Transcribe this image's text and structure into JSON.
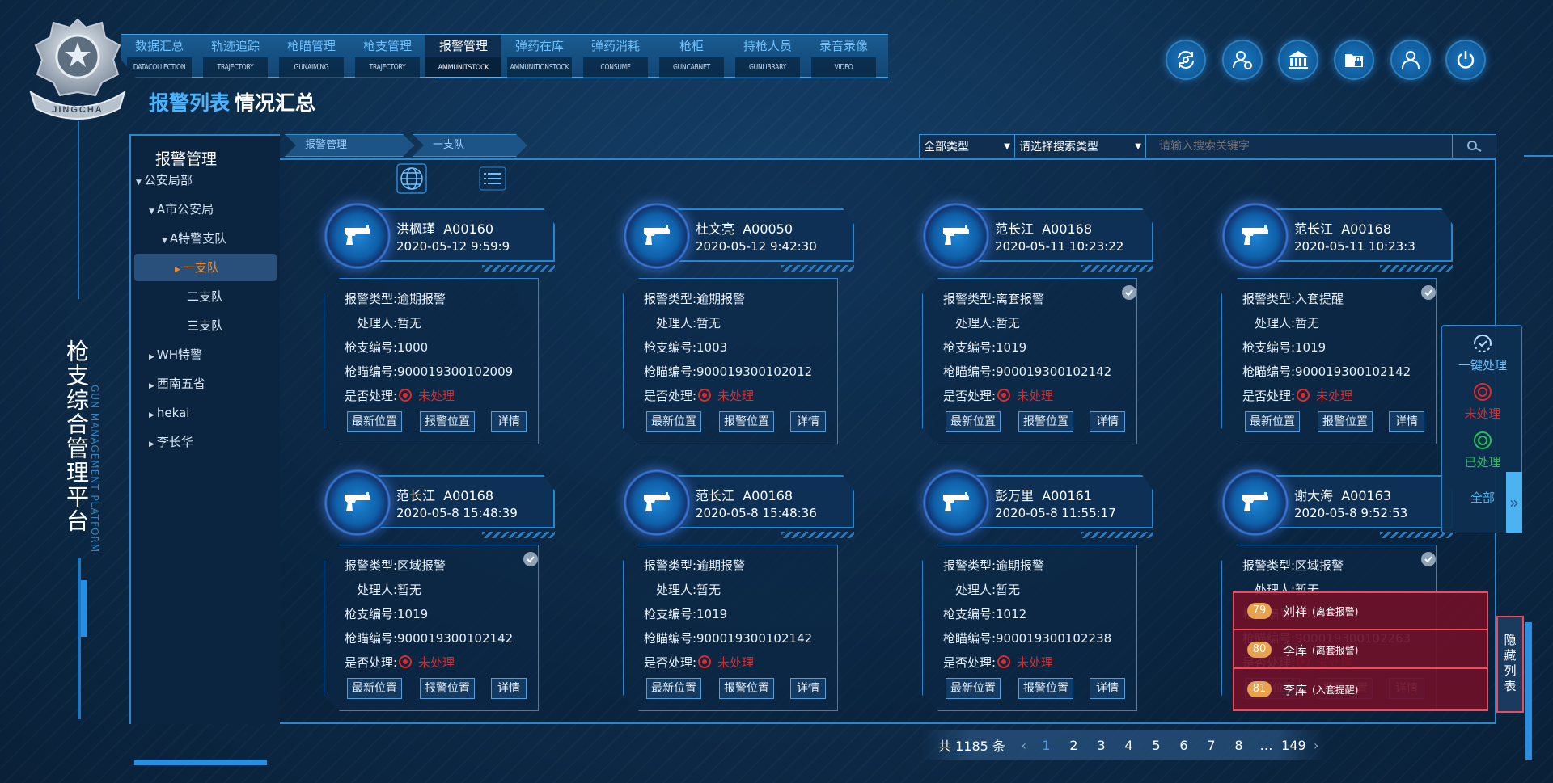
{
  "logo": {
    "text": "JINGCHA"
  },
  "nav": [
    {
      "cn": "数据汇总",
      "en": "DATACOLLECTION"
    },
    {
      "cn": "轨迹追踪",
      "en": "TRAJECTORY"
    },
    {
      "cn": "枪瞄管理",
      "en": "GUNAIMING"
    },
    {
      "cn": "枪支管理",
      "en": "TRAJECTORY"
    },
    {
      "cn": "报警管理",
      "en": "AMMUNITSTOCK",
      "active": true
    },
    {
      "cn": "弹药在库",
      "en": "AMMUNITIONSTOCK"
    },
    {
      "cn": "弹药消耗",
      "en": "CONSUME"
    },
    {
      "cn": "枪柜",
      "en": "GUNCABNET"
    },
    {
      "cn": "持枪人员",
      "en": "GUNLIBRARY"
    },
    {
      "cn": "录音录像",
      "en": "VIDEO"
    }
  ],
  "top_icons": [
    "sync-icon",
    "user-settings-icon",
    "bank-icon",
    "folder-lock-icon",
    "user-icon",
    "power-icon"
  ],
  "page_title": {
    "main": "报警列表",
    "sub": "情况汇总"
  },
  "platform": {
    "cn": "枪支综合管理平台",
    "en": "GUN MANAGEMENT PLATFORM"
  },
  "sidebar": {
    "title": "报警管理",
    "items": [
      {
        "label": "公安局部",
        "arrow": "▼"
      },
      {
        "label": "A市公安局",
        "arrow": "▼"
      },
      {
        "label": "A特警支队",
        "arrow": "▼"
      },
      {
        "label": "一支队",
        "arrow": "▶",
        "active": true
      },
      {
        "label": "二支队",
        "arrow": ""
      },
      {
        "label": "三支队",
        "arrow": ""
      },
      {
        "label": "WH特警",
        "arrow": "▶"
      },
      {
        "label": "西南五省",
        "arrow": "▶"
      },
      {
        "label": "hekai",
        "arrow": "▶"
      },
      {
        "label": "李长华",
        "arrow": "▶"
      }
    ]
  },
  "breadcrumb": [
    "报警管理",
    "一支队"
  ],
  "search": {
    "type_select": "全部类型",
    "field_select": "请选择搜索类型",
    "placeholder": "请输入搜索关键字"
  },
  "card_labels": {
    "type": "报警类型:",
    "handler": "处理人:",
    "gun_no": "枪支编号:",
    "sight_no": "枪瞄编号:",
    "processed": "是否处理:",
    "btn_latest": "最新位置",
    "btn_alarm": "报警位置",
    "btn_detail": "详情"
  },
  "cards": [
    {
      "name": "洪枫瑾",
      "code": "A00160",
      "time": "2020-05-12 9:59:9",
      "type": "逾期报警",
      "handler": "暂无",
      "gun_no": "1000",
      "sight_no": "900019300102009",
      "state": "未处理",
      "checked": false
    },
    {
      "name": "杜文亮",
      "code": "A00050",
      "time": "2020-05-12 9:42:30",
      "type": "逾期报警",
      "handler": "暂无",
      "gun_no": "1003",
      "sight_no": "900019300102012",
      "state": "未处理",
      "checked": false
    },
    {
      "name": "范长江",
      "code": "A00168",
      "time": "2020-05-11 10:23:22",
      "type": "离套报警",
      "handler": "暂无",
      "gun_no": "1019",
      "sight_no": "900019300102142",
      "state": "未处理",
      "checked": true
    },
    {
      "name": "范长江",
      "code": "A00168",
      "time": "2020-05-11 10:23:3",
      "type": "入套提醒",
      "handler": "暂无",
      "gun_no": "1019",
      "sight_no": "900019300102142",
      "state": "未处理",
      "checked": true
    },
    {
      "name": "范长江",
      "code": "A00168",
      "time": "2020-05-8 15:48:39",
      "type": "区域报警",
      "handler": "暂无",
      "gun_no": "1019",
      "sight_no": "900019300102142",
      "state": "未处理",
      "checked": true
    },
    {
      "name": "范长江",
      "code": "A00168",
      "time": "2020-05-8 15:48:36",
      "type": "逾期报警",
      "handler": "暂无",
      "gun_no": "1019",
      "sight_no": "900019300102142",
      "state": "未处理",
      "checked": false
    },
    {
      "name": "彭万里",
      "code": "A00161",
      "time": "2020-05-8 11:55:17",
      "type": "逾期报警",
      "handler": "暂无",
      "gun_no": "1012",
      "sight_no": "900019300102238",
      "state": "未处理",
      "checked": false
    },
    {
      "name": "谢大海",
      "code": "A00163",
      "time": "2020-05-8 9:52:53",
      "type": "区域报警",
      "handler": "暂无",
      "gun_no": "1014",
      "sight_no": "900019300102263",
      "state": "未处理",
      "checked": true
    }
  ],
  "right_panel": {
    "one_click": "一键处理",
    "unprocessed": "未处理",
    "processed": "已处理",
    "all": "全部",
    "colors": {
      "unprocessed": "#e02a2a",
      "processed": "#22c25a",
      "all": "#4db3f0"
    }
  },
  "alerts": [
    {
      "num": "79",
      "name": "刘祥",
      "type": "(离套报警)"
    },
    {
      "num": "80",
      "name": "李库",
      "type": "(离套报警)"
    },
    {
      "num": "81",
      "name": "李库",
      "type": "(入套提醒)"
    }
  ],
  "hide_list": "隐藏列表",
  "pager": {
    "total": "共 1185 条",
    "prev": "‹",
    "next": "›",
    "pages": [
      "1",
      "2",
      "3",
      "4",
      "5",
      "6",
      "7",
      "8",
      "…",
      "149"
    ],
    "current": "1"
  }
}
